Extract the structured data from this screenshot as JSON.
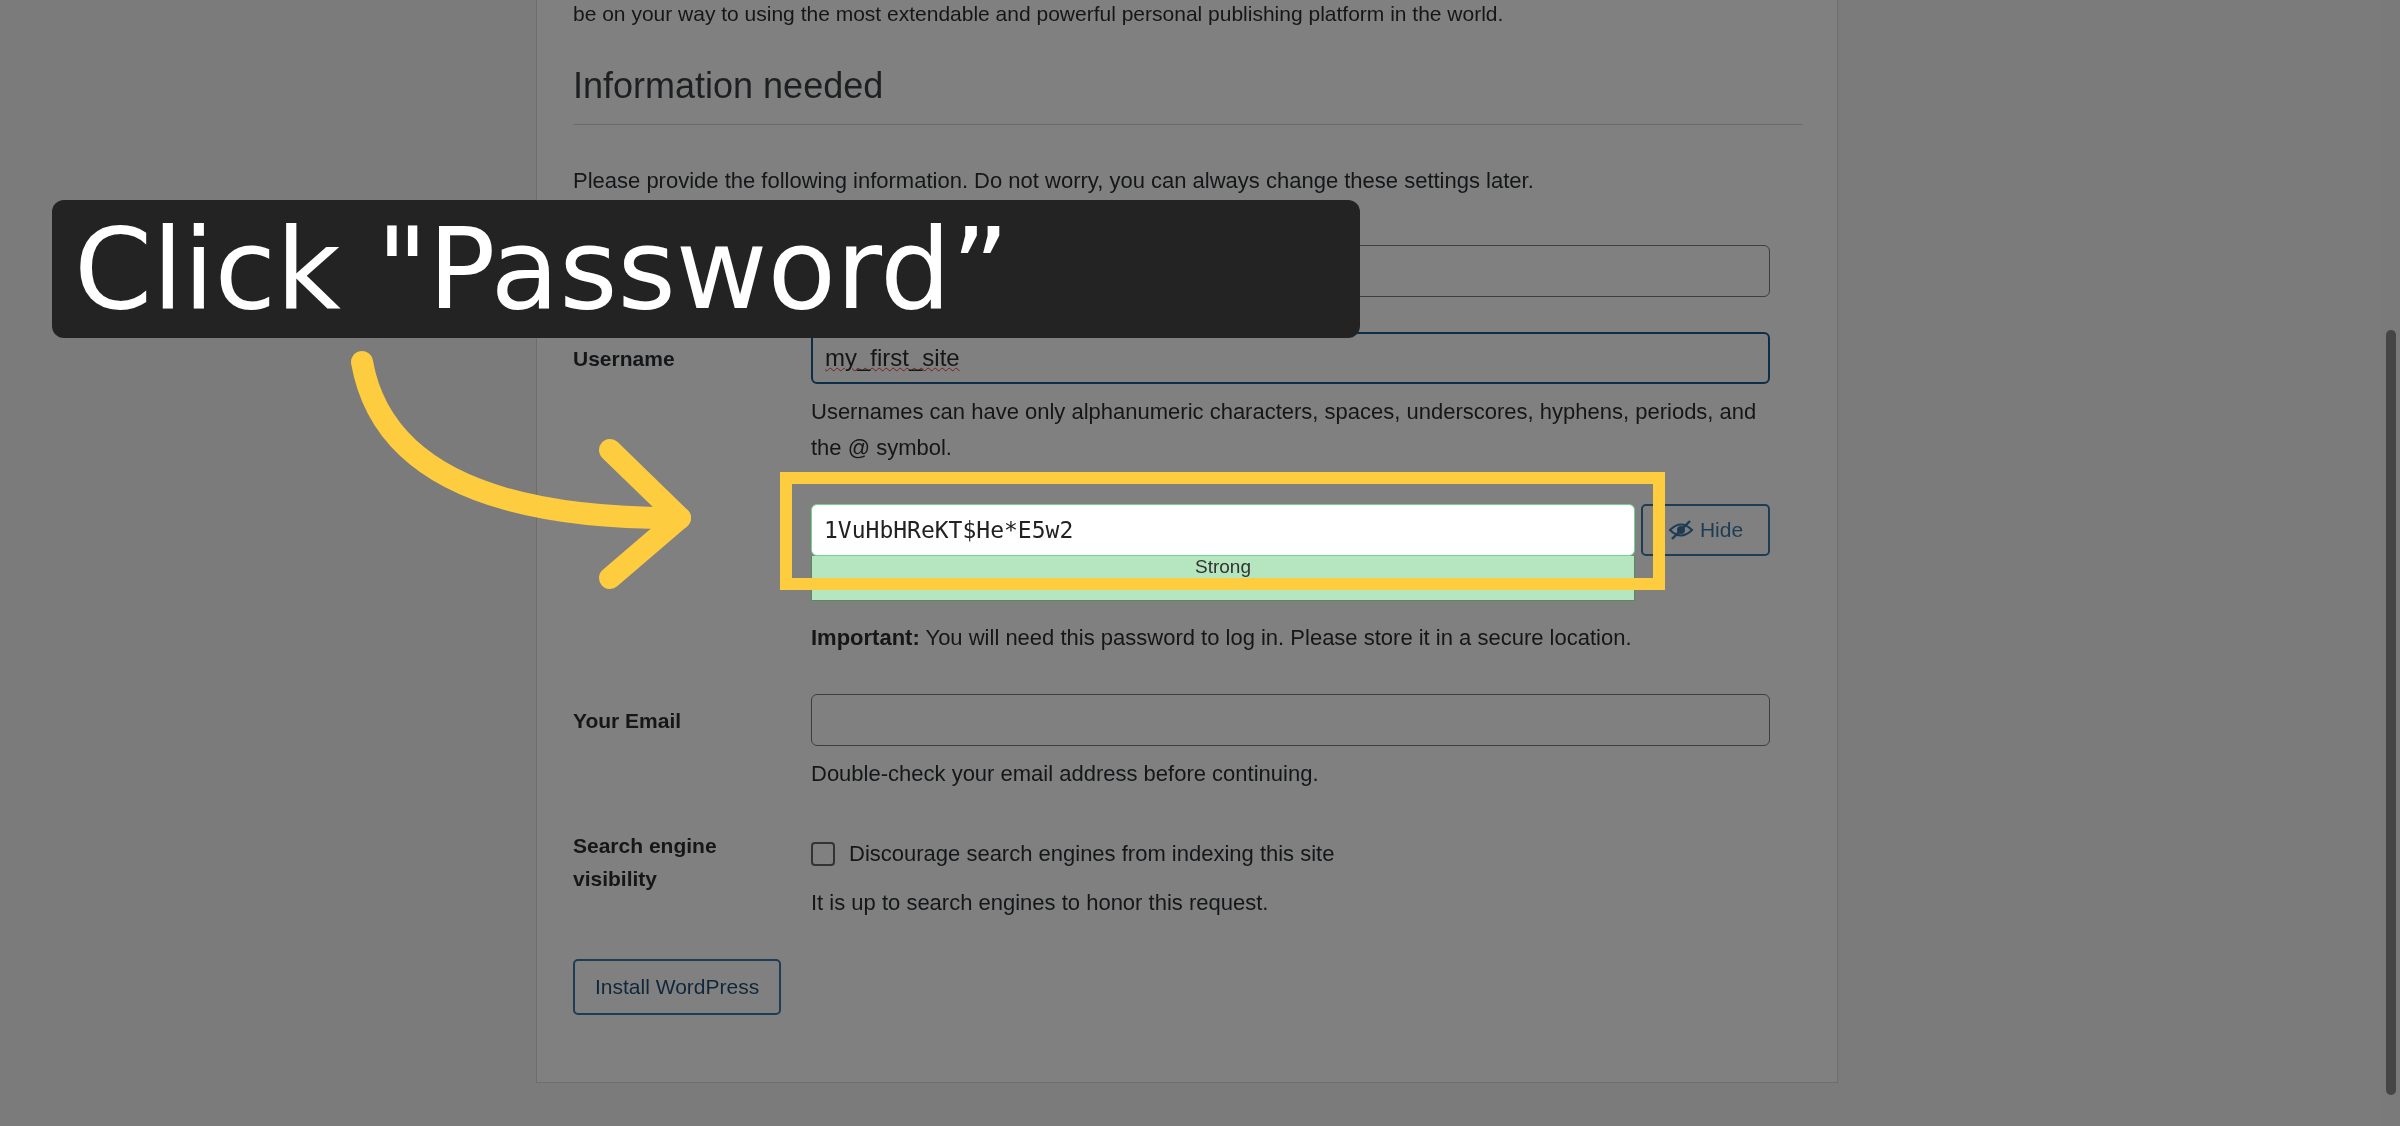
{
  "intro_text": "be on your way to using the most extendable and powerful personal publishing platform in the world.",
  "heading": "Information needed",
  "instructions": "Please provide the following information. Do not worry, you can always change these settings later.",
  "fields": [
    {
      "kind": "text",
      "focused": false
    },
    {
      "kind": "text",
      "label": "Username",
      "value": "my_first_site",
      "focused": true,
      "spelling_error": true,
      "hint": "Usernames can have only alphanumeric characters, spaces, underscores, hyphens, periods, and the @ symbol."
    },
    {
      "kind": "password",
      "value": "1VuHbHReKT$He*E5w2",
      "strength": "Strong",
      "toggle": "Hide",
      "note": "**Important:** You will need this password to log in. Please store it in a secure location."
    },
    {
      "kind": "text",
      "label": "Your Email",
      "focused": false,
      "hint": "Double-check your email address before continuing."
    },
    {
      "kind": "checkbox",
      "label": "Search engine visibility",
      "checkbox_label": "Discourage search engines from indexing this site",
      "checked": false,
      "hint": "It is up to search engines to honor this request."
    }
  ],
  "install_button": "Install WordPress",
  "callout": {
    "text": "Click \"Password”"
  }
}
